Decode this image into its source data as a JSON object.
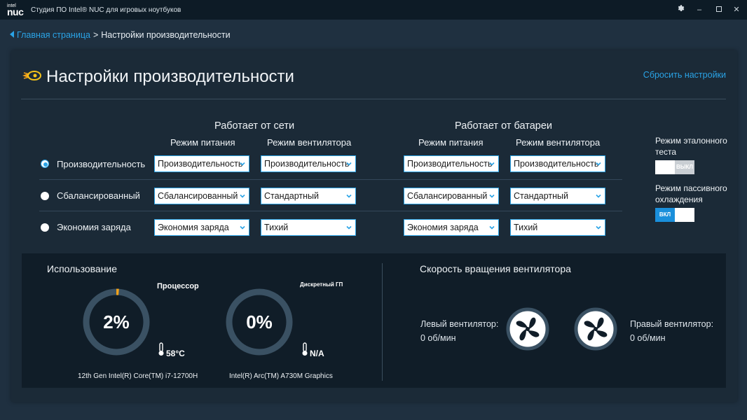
{
  "titlebar": {
    "logo_small": "intel",
    "logo_large": "nuc",
    "title": "Студия ПО Intel® NUC для игровых ноутбуков",
    "icons": [
      "gear-icon",
      "minimize-icon",
      "maximize-icon",
      "close-icon"
    ]
  },
  "breadcrumb": {
    "back": "Главная страница",
    "separator": ">",
    "current": "Настройки производительности"
  },
  "page": {
    "title": "Настройки производительности",
    "reset": "Сбросить настройки"
  },
  "groups": {
    "ac": {
      "title": "Работает от сети",
      "power_header": "Режим питания",
      "fan_header": "Режим вентилятора"
    },
    "battery": {
      "title": "Работает от батареи",
      "power_header": "Режим питания",
      "fan_header": "Режим вентилятора"
    }
  },
  "modes": [
    {
      "label": "Производительность",
      "selected": true,
      "ac_power": "Производительность",
      "ac_fan": "Производительность",
      "bat_power": "Производительность",
      "bat_fan": "Производительность"
    },
    {
      "label": "Сбалансированный",
      "selected": false,
      "ac_power": "Сбалансированный",
      "ac_fan": "Стандартный",
      "bat_power": "Сбалансированный",
      "bat_fan": "Стандартный"
    },
    {
      "label": "Экономия заряда",
      "selected": false,
      "ac_power": "Экономия заряда",
      "ac_fan": "Тихий",
      "bat_power": "Экономия заряда",
      "bat_fan": "Тихий"
    }
  ],
  "side": {
    "benchmark_label": "Режим эталонного теста",
    "benchmark_state": "ВЫКЛ",
    "passive_label": "Режим пассивного охлаждения",
    "passive_state": "ВКЛ"
  },
  "usage": {
    "title": "Использование",
    "cpu": {
      "label": "Процессор",
      "value": "2%",
      "percent": 2,
      "temp": "58°C",
      "device": "12th Gen Intel(R) Core(TM) i7-12700H"
    },
    "gpu": {
      "label": "Дискретный ГП",
      "value": "0%",
      "percent": 0,
      "temp": "N/A",
      "device": "Intel(R) Arc(TM) A730M Graphics"
    }
  },
  "fans": {
    "title": "Скорость вращения вентилятора",
    "left": {
      "label": "Левый вентилятор:",
      "value": "0 об/мин"
    },
    "right": {
      "label": "Правый вентилятор:",
      "value": "0 об/мин"
    }
  },
  "colors": {
    "accent": "#2aa3e6",
    "gauge_ring": "#3a5163",
    "gauge_indicator": "#f2a21b",
    "panel": "#1b2a37",
    "bottom": "#101d28"
  }
}
